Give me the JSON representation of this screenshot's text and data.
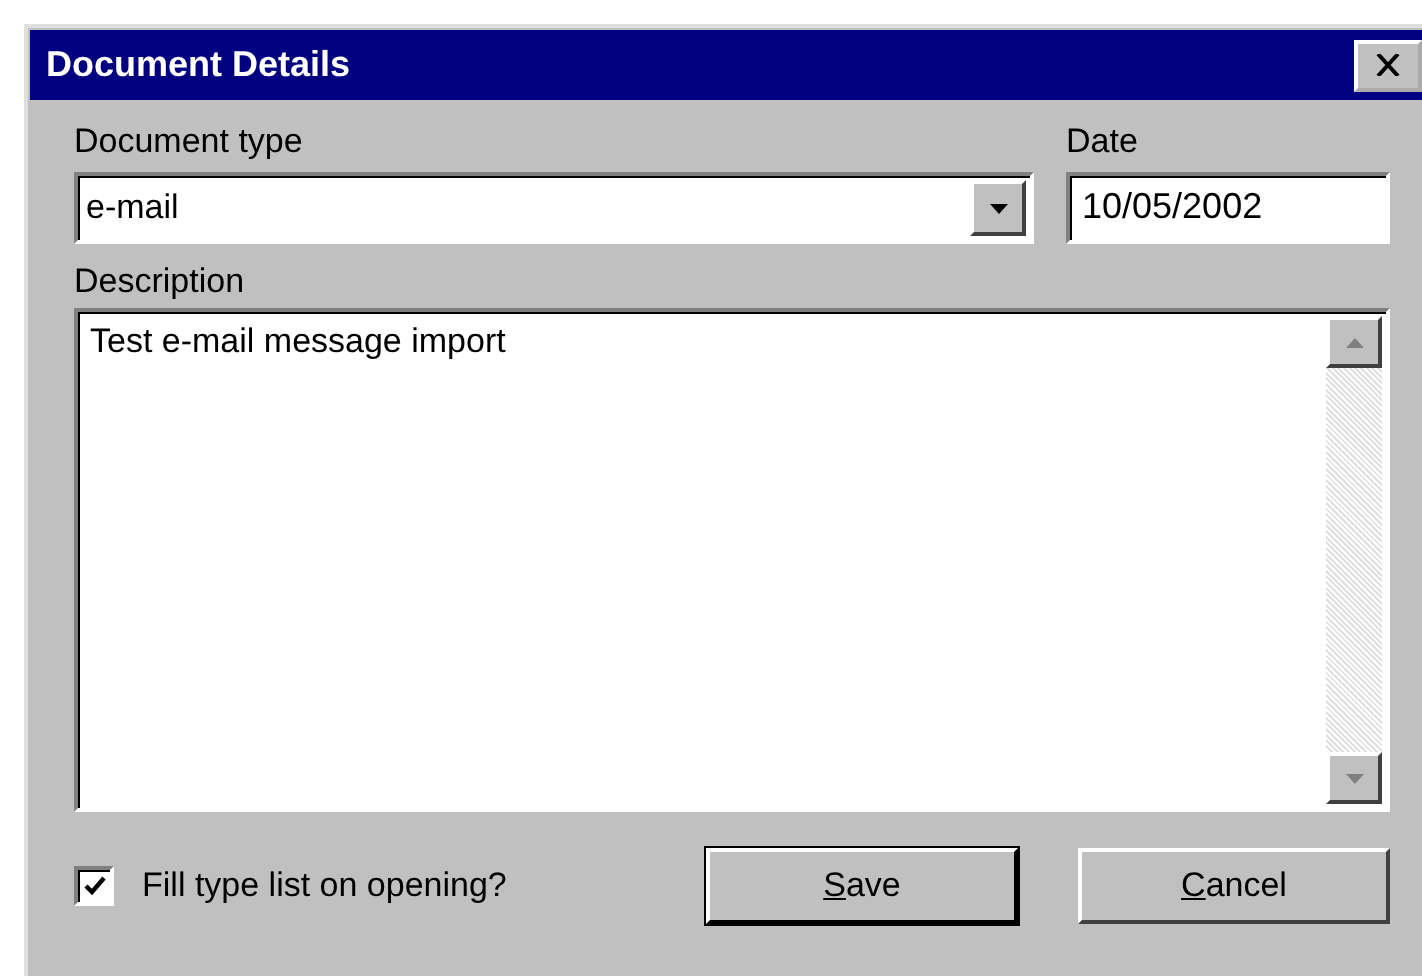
{
  "window": {
    "title": "Document Details"
  },
  "document_type": {
    "label": "Document type",
    "value": "e-mail"
  },
  "date": {
    "label": "Date",
    "value": "10/05/2002"
  },
  "description": {
    "label": "Description",
    "value": "Test e-mail message import"
  },
  "fill_type_list": {
    "label": "Fill type list on opening?",
    "checked": true
  },
  "buttons": [
    {
      "accel": "S",
      "rest": "ave",
      "default": true
    },
    {
      "accel": "C",
      "rest": "ancel",
      "default": false
    }
  ]
}
